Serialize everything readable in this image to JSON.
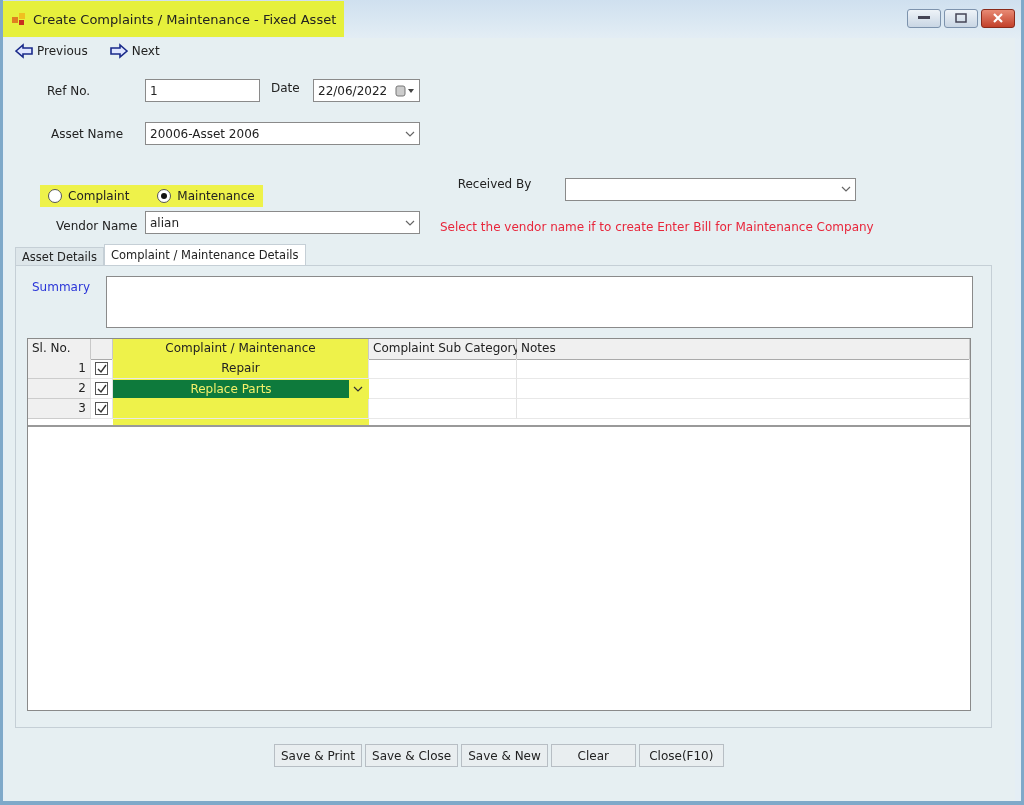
{
  "window": {
    "title": "Create Complaints / Maintenance - Fixed Asset",
    "highlighted": true
  },
  "toolbar": [
    {
      "label": "Previous",
      "kind": "previous"
    },
    {
      "label": "Next",
      "kind": "next"
    }
  ],
  "form": {
    "ref_no": {
      "label": "Ref No.",
      "value": "1"
    },
    "date": {
      "label": "Date",
      "value": "22/06/2022"
    },
    "asset_name": {
      "label": "Asset Name",
      "value": "20006-Asset 2006"
    },
    "type_highlighted": true,
    "type_options": [
      {
        "label": "Complaint",
        "selected": false
      },
      {
        "label": "Maintenance",
        "selected": true
      }
    ],
    "received_by": {
      "label": "Received By"
    },
    "vendor_name": {
      "label": "Vendor Name",
      "value": "alian"
    },
    "vendor_note": "Select the vendor name if to create Enter Bill for Maintenance Company"
  },
  "tabs": [
    {
      "label": "Asset Details",
      "selected": false
    },
    {
      "label": "Complaint / Maintenance Details",
      "selected": true
    }
  ],
  "summary": {
    "label": "Summary"
  },
  "grid": {
    "columns": [
      {
        "kind": "number",
        "label": "Sl. No."
      },
      {
        "kind": "check"
      },
      {
        "kind": "text",
        "label": "Complaint / Maintenance",
        "highlighted": true
      },
      {
        "kind": "text",
        "label": "Complaint Sub Category"
      },
      {
        "kind": "text",
        "label": "Notes"
      }
    ],
    "rows": [
      {
        "sl_no": "1",
        "checked": true,
        "complaint_maintenance": "Repair",
        "selected": false
      },
      {
        "sl_no": "2",
        "checked": true,
        "complaint_maintenance": "Replace Parts",
        "selected": true
      },
      {
        "sl_no": "3",
        "checked": true,
        "selected": false
      }
    ]
  },
  "buttons": [
    "Save & Print",
    "Save & Close",
    "Save & New",
    "Clear",
    "Close(F10)"
  ]
}
